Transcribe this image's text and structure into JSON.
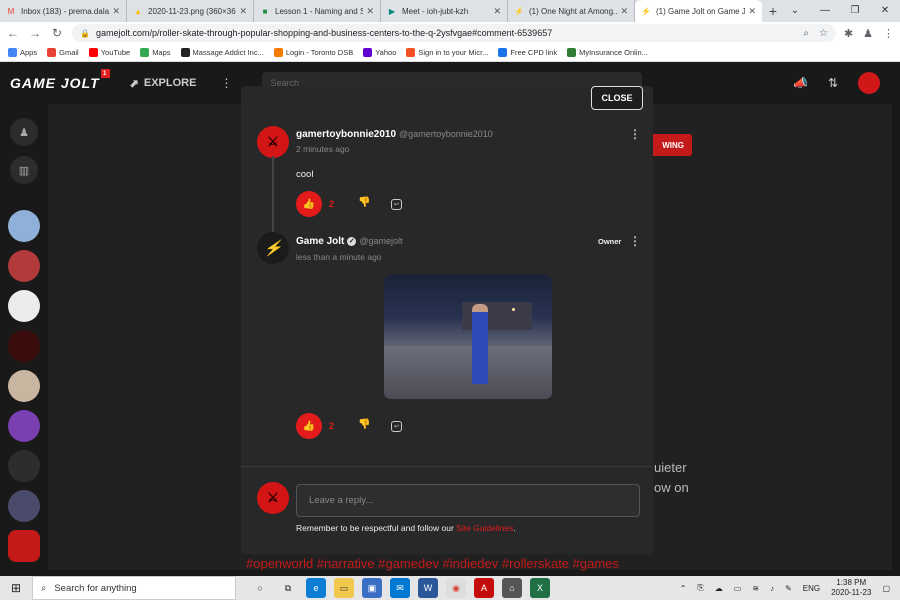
{
  "browser": {
    "tabs": [
      {
        "title": "Inbox (183) - prerna.dalal...",
        "favicon": "gmail-icon",
        "fav_color": "#ea4335",
        "fav_glyph": "M"
      },
      {
        "title": "2020-11-23.png (360×360)",
        "favicon": "drive-image-icon",
        "fav_color": "#fbbc04",
        "fav_glyph": "▲"
      },
      {
        "title": "Lesson 1 - Naming and Sa...",
        "favicon": "classroom-icon",
        "fav_color": "#1e8e3e",
        "fav_glyph": "■"
      },
      {
        "title": "Meet - ioh-jubt-kzh",
        "favicon": "meet-icon",
        "fav_color": "#00897b",
        "fav_glyph": "▶"
      },
      {
        "title": "(1) One Night at Among...",
        "favicon": "gamejolt-icon",
        "fav_color": "#2f7f5f",
        "fav_glyph": "⚡"
      },
      {
        "title": "(1) Game Jolt on Game Jo...",
        "favicon": "gamejolt-icon",
        "fav_color": "#2f7f5f",
        "fav_glyph": "⚡"
      }
    ],
    "active_tab": 5,
    "new_tab": "+",
    "url": "gamejolt.com/p/roller-skate-through-popular-shopping-and-business-centers-to-the-q-2ysfvgae#comment-6539657",
    "bookmarks": [
      {
        "label": "Apps",
        "color": "#4285f4"
      },
      {
        "label": "Gmail",
        "color": "#ea4335"
      },
      {
        "label": "YouTube",
        "color": "#ff0000"
      },
      {
        "label": "Maps",
        "color": "#34a853"
      },
      {
        "label": "Massage Addict Inc...",
        "color": "#222222"
      },
      {
        "label": "Login - Toronto DSB",
        "color": "#f57c00"
      },
      {
        "label": "Yahoo",
        "color": "#6001d2"
      },
      {
        "label": "Sign in to your Micr...",
        "color": "#f25022"
      },
      {
        "label": "Free CPD link",
        "color": "#1a73e8"
      },
      {
        "label": "MyInsurance Onlin...",
        "color": "#2e7d32"
      }
    ]
  },
  "site": {
    "logo": "GAME JOLT",
    "notif_count": "1",
    "explore": "EXPLORE",
    "search_placeholder": "Search",
    "follow_partial": "WING",
    "bg_text_1": "uieter",
    "bg_text_2": "ow on",
    "tags": "#openworld #narrative #gamedev #indiedev #rollerskate #games"
  },
  "modal": {
    "close_label": "CLOSE",
    "comment1": {
      "name": "gamertoybonnie2010",
      "handle": "@gamertoybonnie2010",
      "time": "2 minutes ago",
      "body": "cool",
      "likes": "2"
    },
    "comment2": {
      "name": "Game Jolt",
      "handle": "@gamejolt",
      "time": "less than a minute ago",
      "badge": "Owner",
      "likes": "2"
    },
    "reply_placeholder": "Leave a reply...",
    "guidelines_text": "Remember to be respectful and follow our ",
    "guidelines_link": "Site Guidelines",
    "guidelines_end": "."
  },
  "taskbar": {
    "search_placeholder": "Search for anything",
    "lang": "ENG",
    "time": "1:38 PM",
    "date": "2020-11-23"
  }
}
